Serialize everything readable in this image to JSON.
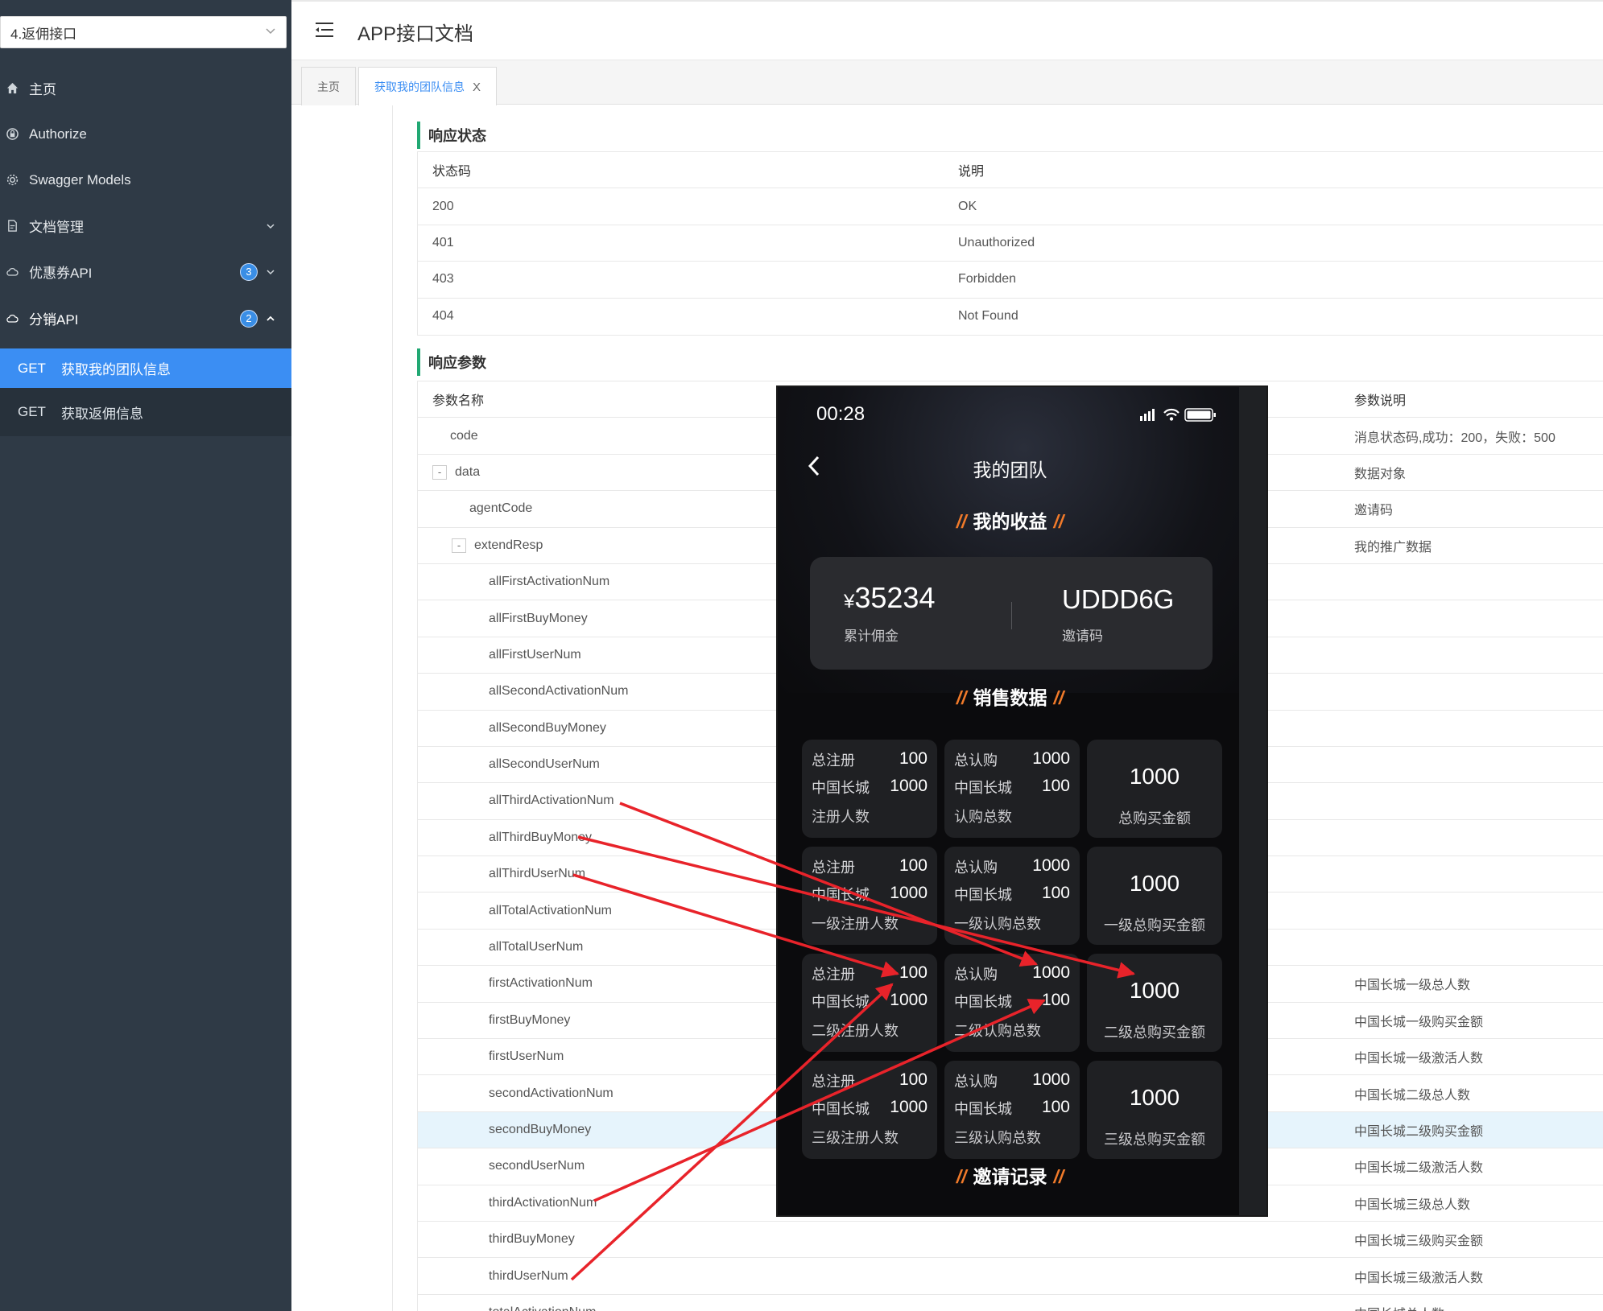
{
  "sidebar": {
    "group_select": "4.返佣接口",
    "menu": [
      {
        "label": "主页",
        "icon": "home-icon"
      },
      {
        "label": "Authorize",
        "icon": "lock-icon"
      },
      {
        "label": "Swagger Models",
        "icon": "gear-icon"
      },
      {
        "label": "文档管理",
        "icon": "doc-icon"
      },
      {
        "label": "优惠券API",
        "icon": "cloud-icon",
        "badge": "3"
      },
      {
        "label": "分销API",
        "icon": "cloud-icon",
        "badge": "2"
      }
    ],
    "submenu": [
      {
        "method": "GET",
        "label": "获取我的团队信息",
        "active": true
      },
      {
        "method": "GET",
        "label": "获取返佣信息",
        "active": false
      }
    ]
  },
  "header": {
    "title": "APP接口文档"
  },
  "tabs": [
    {
      "label": "主页"
    },
    {
      "label": "获取我的团队信息",
      "close": "X"
    }
  ],
  "response_status": {
    "title": "响应状态",
    "headers": [
      "状态码",
      "说明"
    ],
    "rows": [
      [
        "200",
        "OK"
      ],
      [
        "401",
        "Unauthorized"
      ],
      [
        "403",
        "Forbidden"
      ],
      [
        "404",
        "Not Found"
      ]
    ]
  },
  "response_params": {
    "title": "响应参数",
    "headers": [
      "参数名称",
      "参数说明"
    ],
    "rows": [
      {
        "name": "code",
        "desc": "消息状态码,成功：200，失败：500"
      },
      {
        "name": "data",
        "desc": "数据对象",
        "expander": "-"
      },
      {
        "name": "agentCode",
        "desc": "邀请码"
      },
      {
        "name": "extendResp",
        "desc": "我的推广数据",
        "expander": "-"
      },
      {
        "name": "allFirstActivationNum",
        "desc": ""
      },
      {
        "name": "allFirstBuyMoney",
        "desc": ""
      },
      {
        "name": "allFirstUserNum",
        "desc": ""
      },
      {
        "name": "allSecondActivationNum",
        "desc": ""
      },
      {
        "name": "allSecondBuyMoney",
        "desc": ""
      },
      {
        "name": "allSecondUserNum",
        "desc": ""
      },
      {
        "name": "allThirdActivationNum",
        "desc": ""
      },
      {
        "name": "allThirdBuyMoney",
        "desc": ""
      },
      {
        "name": "allThirdUserNum",
        "desc": ""
      },
      {
        "name": "allTotalActivationNum",
        "desc": ""
      },
      {
        "name": "allTotalUserNum",
        "desc": ""
      },
      {
        "name": "firstActivationNum",
        "desc": "中国长城一级总人数"
      },
      {
        "name": "firstBuyMoney",
        "desc": "中国长城一级购买金额"
      },
      {
        "name": "firstUserNum",
        "desc": "中国长城一级激活人数"
      },
      {
        "name": "secondActivationNum",
        "desc": "中国长城二级总人数"
      },
      {
        "name": "secondBuyMoney",
        "desc": "中国长城二级购买金额",
        "highlight": true
      },
      {
        "name": "secondUserNum",
        "desc": "中国长城二级激活人数"
      },
      {
        "name": "thirdActivationNum",
        "desc": "中国长城三级总人数"
      },
      {
        "name": "thirdBuyMoney",
        "desc": "中国长城三级购买金额"
      },
      {
        "name": "thirdUserNum",
        "desc": "中国长城三级激活人数"
      },
      {
        "name": "totalActivationNum",
        "desc": "中国长城总人数"
      }
    ]
  },
  "phone": {
    "time": "00:28",
    "title": "我的团队",
    "earnings_section": "我的收益",
    "commission_value": "35234",
    "yen": "¥",
    "commission_label": "累计佣金",
    "invite_code": "UDDD6G",
    "invite_label": "邀请码",
    "sales_section": "销售数据",
    "records_section": "邀请记录",
    "slash": "//",
    "rows": [
      {
        "reg_total": "100",
        "reg_cw": "1000",
        "reg_cap": "注册人数",
        "sub_total": "1000",
        "sub_cw": "100",
        "sub_cap": "认购总数",
        "buy": "1000",
        "buy_cap": "总购买金额"
      },
      {
        "reg_total": "100",
        "reg_cw": "1000",
        "reg_cap": "一级注册人数",
        "sub_total": "1000",
        "sub_cw": "100",
        "sub_cap": "一级认购总数",
        "buy": "1000",
        "buy_cap": "一级总购买金额"
      },
      {
        "reg_total": "100",
        "reg_cw": "1000",
        "reg_cap": "二级注册人数",
        "sub_total": "1000",
        "sub_cw": "100",
        "sub_cap": "二级认购总数",
        "buy": "1000",
        "buy_cap": "二级总购买金额"
      },
      {
        "reg_total": "100",
        "reg_cw": "1000",
        "reg_cap": "三级注册人数",
        "sub_total": "1000",
        "sub_cw": "100",
        "sub_cap": "三级认购总数",
        "buy": "1000",
        "buy_cap": "三级总购买金额"
      }
    ],
    "k_reg_total": "总注册",
    "k_cw": "中国长城",
    "k_sub_total": "总认购"
  },
  "annotation_color": "#e8232a"
}
